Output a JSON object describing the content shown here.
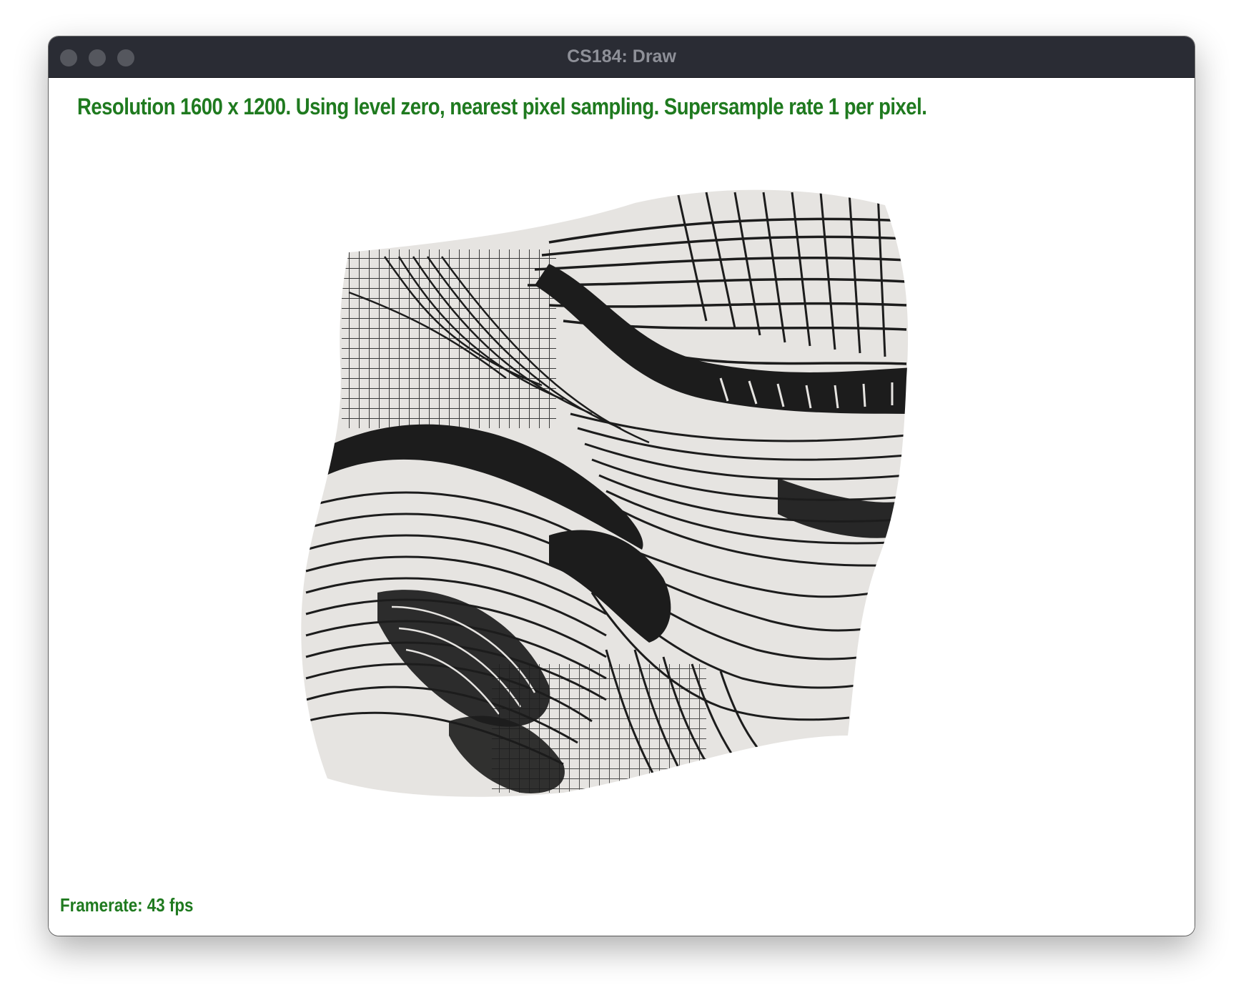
{
  "window": {
    "title": "CS184: Draw"
  },
  "viewport": {
    "info_text": "Resolution 1600 x 1200. Using level zero, nearest pixel sampling. Supersample rate 1 per pixel.",
    "framerate_text": "Framerate: 43 fps",
    "text_color": "#1f7a1f",
    "rendered_image": "warped-textured-square"
  },
  "colors": {
    "titlebar": "#2a2c34",
    "title_text": "#8e9098",
    "traffic_light": "#55575e",
    "texture_light": "#e6e4e1",
    "texture_dark": "#1c1c1c"
  }
}
